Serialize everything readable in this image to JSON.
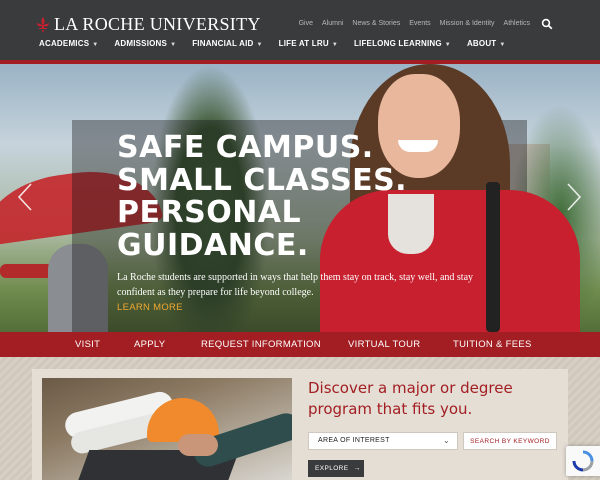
{
  "header": {
    "logo_text": "LA ROCHE UNIVERSITY",
    "utility_links": [
      "Give",
      "Alumni",
      "News & Stories",
      "Events",
      "Mission & Identity",
      "Athletics"
    ],
    "search_icon": "search-icon",
    "main_nav": [
      "ACADEMICS",
      "ADMISSIONS",
      "FINANCIAL AID",
      "LIFE AT LRU",
      "LIFELONG LEARNING",
      "ABOUT"
    ]
  },
  "hero": {
    "headline": [
      "SAFE CAMPUS.",
      "SMALL CLASSES.",
      "PERSONAL",
      "GUIDANCE."
    ],
    "body": "La Roche students are supported in ways that help them stay on track, stay well, and stay confident as they prepare for life beyond college.",
    "link": "LEARN MORE"
  },
  "actions": [
    "VISIT",
    "APPLY",
    "REQUEST INFORMATION",
    "VIRTUAL TOUR",
    "TUITION & FEES"
  ],
  "finder": {
    "heading": "Discover a major or degree program that fits you.",
    "select_value": "AREA OF INTEREST",
    "keyword_button": "SEARCH BY KEYWORD",
    "explore_button": "EXPLORE"
  },
  "colors": {
    "brand_red": "#a31e22",
    "header_gray": "#3a3b3d",
    "link_gold": "#f0a830"
  }
}
